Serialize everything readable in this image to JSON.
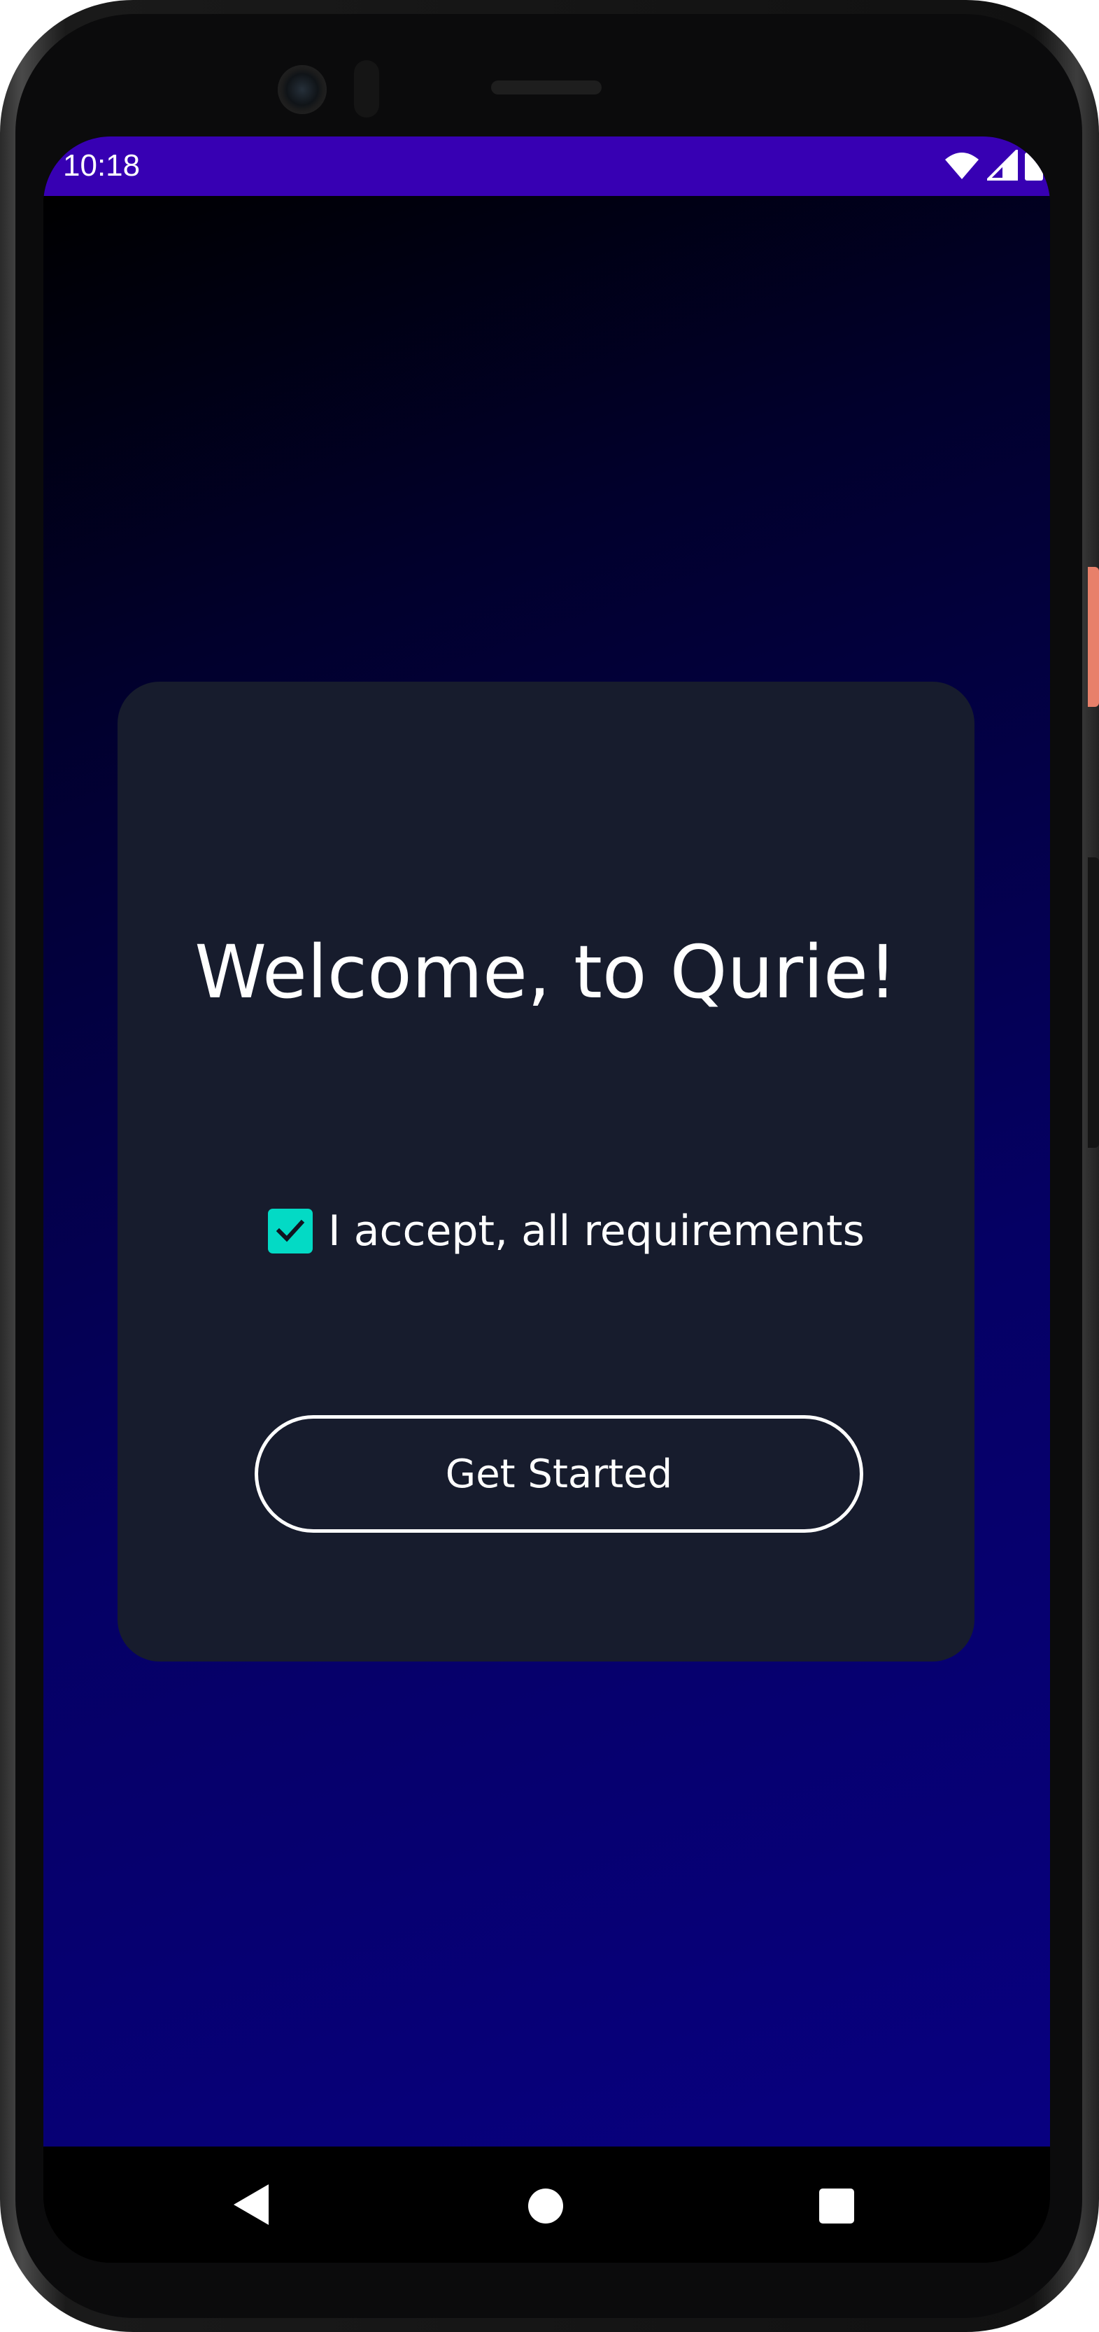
{
  "status_bar": {
    "time": "10:18",
    "icons": [
      "wifi-icon",
      "cellular-signal-icon",
      "battery-icon"
    ],
    "background_color": "#3700b3"
  },
  "welcome": {
    "title": "Welcome, to Qurie!"
  },
  "terms": {
    "checkbox_checked": true,
    "label": "I accept, all requirements",
    "checkbox_color": "#03dac5"
  },
  "actions": {
    "get_started_label": "Get Started"
  },
  "navigation": {
    "icons": [
      "back-icon",
      "home-icon",
      "recents-icon"
    ]
  },
  "colors": {
    "card_background": "#171c2d",
    "gradient_top": "#000000",
    "gradient_bottom": "#080080"
  }
}
